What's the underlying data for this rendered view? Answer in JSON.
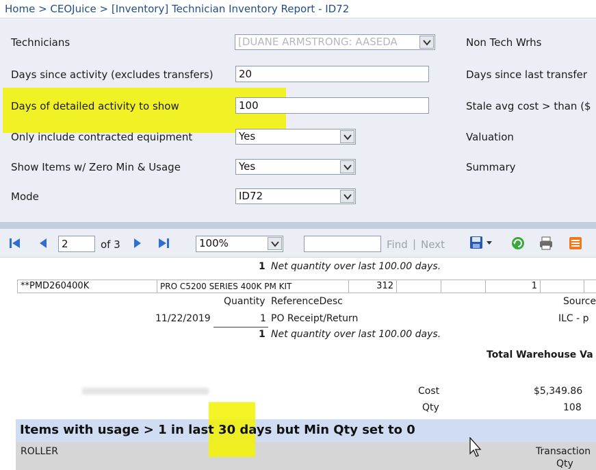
{
  "breadcrumb": {
    "text": "Home > CEOJuice > [Inventory] Technician Inventory Report - ID72"
  },
  "params": {
    "technicians": {
      "label": "Technicians",
      "value": "[DUANE ARMSTRONG: AASEDA"
    },
    "days_since_activity": {
      "label": "Days since activity (excludes transfers)",
      "value": "20"
    },
    "days_detailed": {
      "label": "Days of detailed activity to show",
      "value": "100"
    },
    "contracted": {
      "label": "Only include contracted equipment",
      "value": "Yes"
    },
    "zero_min": {
      "label": "Show Items w/ Zero Min & Usage",
      "value": "Yes"
    },
    "mode": {
      "label": "Mode",
      "value": "ID72"
    },
    "right_labels": {
      "non_tech": "Non Tech Wrhs",
      "days_last_transfer": "Days since last transfer",
      "stale": "Stale avg cost > than ($",
      "valuation": "Valuation",
      "summary": "Summary"
    }
  },
  "toolbar": {
    "page_value": "2",
    "of_pages": "of 3",
    "zoom": "100%",
    "find": "Find",
    "divider": "|",
    "next": "Next"
  },
  "report": {
    "net_qty_1": "1",
    "net_text_1": "Net quantity over last 100.00 days.",
    "item_code": "**PMD260400K",
    "item_desc": "PRO C5200 SERIES 400K PM KIT",
    "item_num": "312",
    "item_qty": "1",
    "hdr_quantity": "Quantity",
    "hdr_refdesc": "ReferenceDesc",
    "hdr_source": "Source",
    "row_date": "11/22/2019",
    "row_qty": "1",
    "row_ref": "PO Receipt/Return",
    "row_source": "ILC - p",
    "net_qty_2": "1",
    "net_text_2": "Net quantity over last 100.00 days.",
    "total_label": "Total Warehouse Va",
    "cost_label": "Cost",
    "cost_value": "$5,349.86",
    "qty_label": "Qty",
    "qty_value": "108",
    "banner": "Items with usage > 1 in last 30 days but Min Qty set to 0",
    "col_roller": "ROLLER",
    "col_transaction": "Transaction",
    "col_qty": "Qty"
  }
}
